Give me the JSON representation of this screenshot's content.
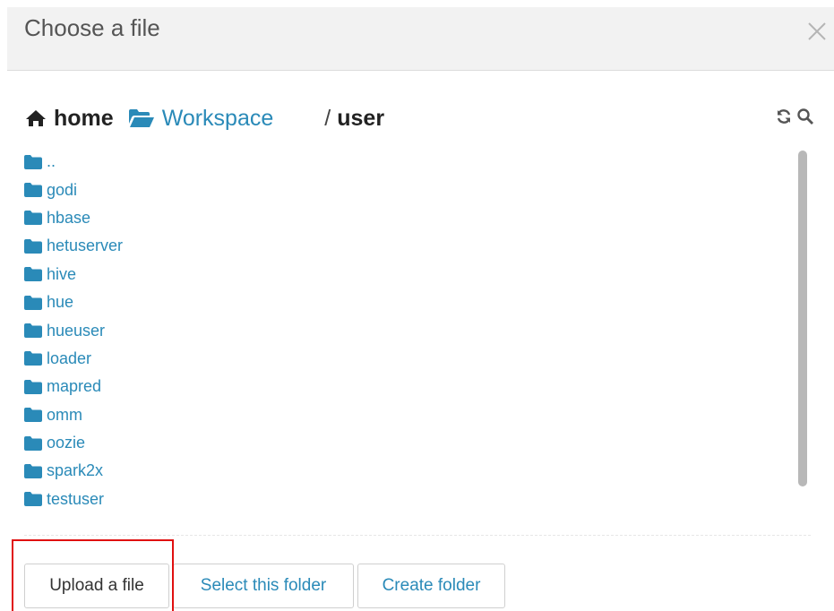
{
  "dialog": {
    "title": "Choose a file",
    "close_icon": "close-icon"
  },
  "breadcrumb": {
    "home_icon": "home-icon",
    "home_label": "home",
    "workspace_icon": "folder-open-icon",
    "workspace_label": "Workspace",
    "separator": "/",
    "current": "user"
  },
  "tools": {
    "refresh_icon": "refresh-icon",
    "search_icon": "search-icon"
  },
  "files": {
    "item_icon": "folder-icon",
    "items": [
      {
        "name": ".."
      },
      {
        "name": "godi"
      },
      {
        "name": "hbase"
      },
      {
        "name": "hetuserver"
      },
      {
        "name": "hive"
      },
      {
        "name": "hue"
      },
      {
        "name": "hueuser"
      },
      {
        "name": "loader"
      },
      {
        "name": "mapred"
      },
      {
        "name": "omm"
      },
      {
        "name": "oozie"
      },
      {
        "name": "spark2x"
      },
      {
        "name": "testuser"
      }
    ]
  },
  "footer": {
    "upload_label": "Upload a file",
    "select_label": "Select this folder",
    "create_label": "Create folder"
  },
  "colors": {
    "link": "#2a8ab8",
    "header_bg": "#f2f2f2",
    "highlight": "#e01010"
  }
}
